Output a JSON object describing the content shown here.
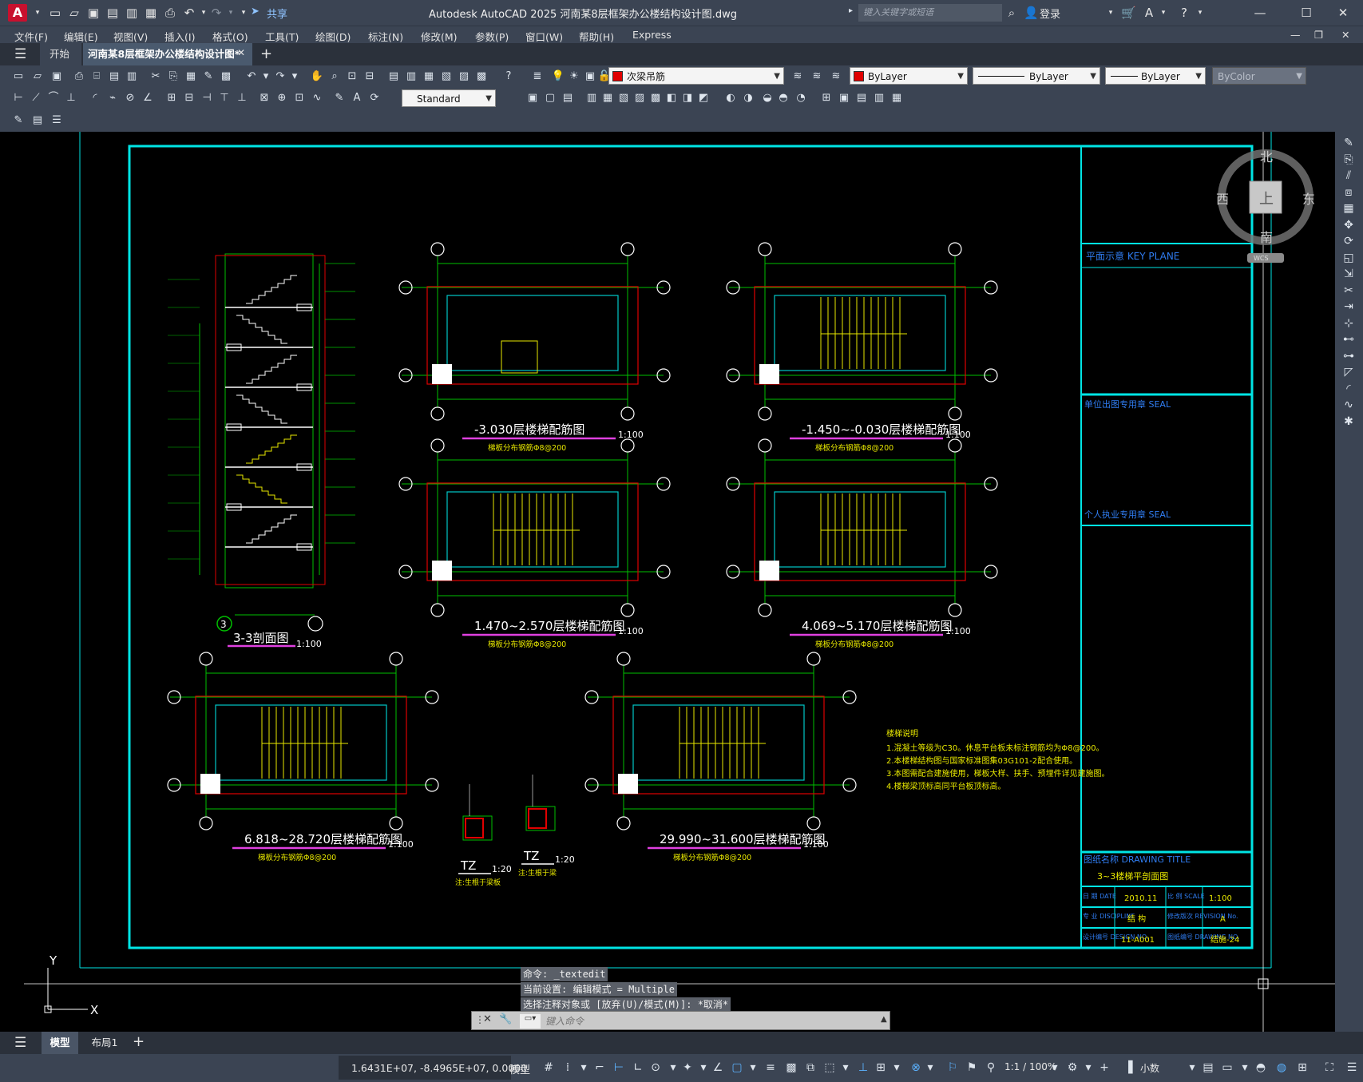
{
  "app": {
    "logo": "A",
    "title": "Autodesk AutoCAD 2025    河南某8层框架办公楼结构设计图.dwg",
    "share": "共享",
    "search_placeholder": "键入关键字或短语",
    "login": "登录"
  },
  "menu": [
    "文件(F)",
    "编辑(E)",
    "视图(V)",
    "插入(I)",
    "格式(O)",
    "工具(T)",
    "绘图(D)",
    "标注(N)",
    "修改(M)",
    "参数(P)",
    "窗口(W)",
    "帮助(H)",
    "Express"
  ],
  "tabs": {
    "start": "开始",
    "document": "河南某8层框架办公楼结构设计图*"
  },
  "toolbar": {
    "layer_name": "次梁吊筋",
    "text_style": "Standard",
    "color": "ByLayer",
    "linetype": "ByLayer",
    "lineweight": "ByLayer",
    "plotstyle": "ByColor",
    "layer_color": "#e00000"
  },
  "viewcube": {
    "north": "北",
    "south": "南",
    "east": "东",
    "west": "西",
    "top": "上",
    "wcs": "WCS"
  },
  "drawing": {
    "section_title": "3-3剖面图",
    "section_scale": "1:100",
    "plans": [
      {
        "title": "-3.030层楼梯配筋图",
        "scale": "1:100",
        "note": "梯板分布钢筋Φ8@200"
      },
      {
        "title": "-1.450~-0.030层楼梯配筋图",
        "scale": "1:100",
        "note": "梯板分布钢筋Φ8@200"
      },
      {
        "title": "1.470~2.570层楼梯配筋图",
        "scale": "1:100",
        "note": "梯板分布钢筋Φ8@200"
      },
      {
        "title": "4.069~5.170层楼梯配筋图",
        "scale": "1:100",
        "note": "梯板分布钢筋Φ8@200"
      },
      {
        "title": "6.818~28.720层楼梯配筋图",
        "scale": "1:100",
        "note": "梯板分布钢筋Φ8@200"
      },
      {
        "title": "29.990~31.600层楼梯配筋图",
        "scale": "1:100",
        "note": "梯板分布钢筋Φ8@200"
      }
    ],
    "tz": [
      {
        "label": "TZ",
        "scale": "1:20",
        "note": "注:生根于梁板"
      },
      {
        "label": "TZ",
        "scale": "1:20",
        "note": "注:生根于梁"
      }
    ],
    "notes_title": "楼梯说明",
    "notes": [
      "1.混凝土等级为C30。休息平台板未标注钢筋均为Φ8@200。",
      "2.本楼梯结构图与国家标准图集03G101-2配合使用。",
      "3.本图需配合建施使用，梯板大样、扶手、预埋件详见建施图。",
      "4.楼梯梁顶标高同平台板顶标高。"
    ],
    "titleblock": {
      "key_plan": "平面示意 KEY PLANE",
      "unit_seal": "单位出图专用章 SEAL",
      "personal_seal": "个人执业专用章 SEAL",
      "drawing_title_label": "图纸名称 DRAWING TITLE",
      "drawing_title": "3~3楼梯平剖面图",
      "date_label": "日 期 DATE",
      "date": "2010.11",
      "scale_label": "比 例 SCALE",
      "scale": "1:100",
      "discipline_label": "专 业 DISCIPLINE",
      "discipline": "结 构",
      "revision_label": "修改版次 REVISION No.",
      "revision": "A",
      "design_no_label": "设计编号 DESIGN NO.",
      "design_no": "11-A001",
      "drawing_no_label": "图纸编号 DRAWING NO.",
      "drawing_no": "结施-24"
    },
    "ucs": {
      "y": "Y",
      "x": "X"
    }
  },
  "command": {
    "history": [
      "命令: _textedit",
      "当前设置: 编辑模式 = Multiple",
      "选择注释对象或 [放弃(U)/模式(M)]: *取消*"
    ],
    "placeholder": "键入命令"
  },
  "layout_tabs": {
    "model": "模型",
    "layout1": "布局1"
  },
  "status": {
    "coords": "1.6431E+07, -8.4965E+07, 0.0000",
    "mode": "模型",
    "annotation_scale": "1:1 / 100%",
    "units": "小数"
  }
}
